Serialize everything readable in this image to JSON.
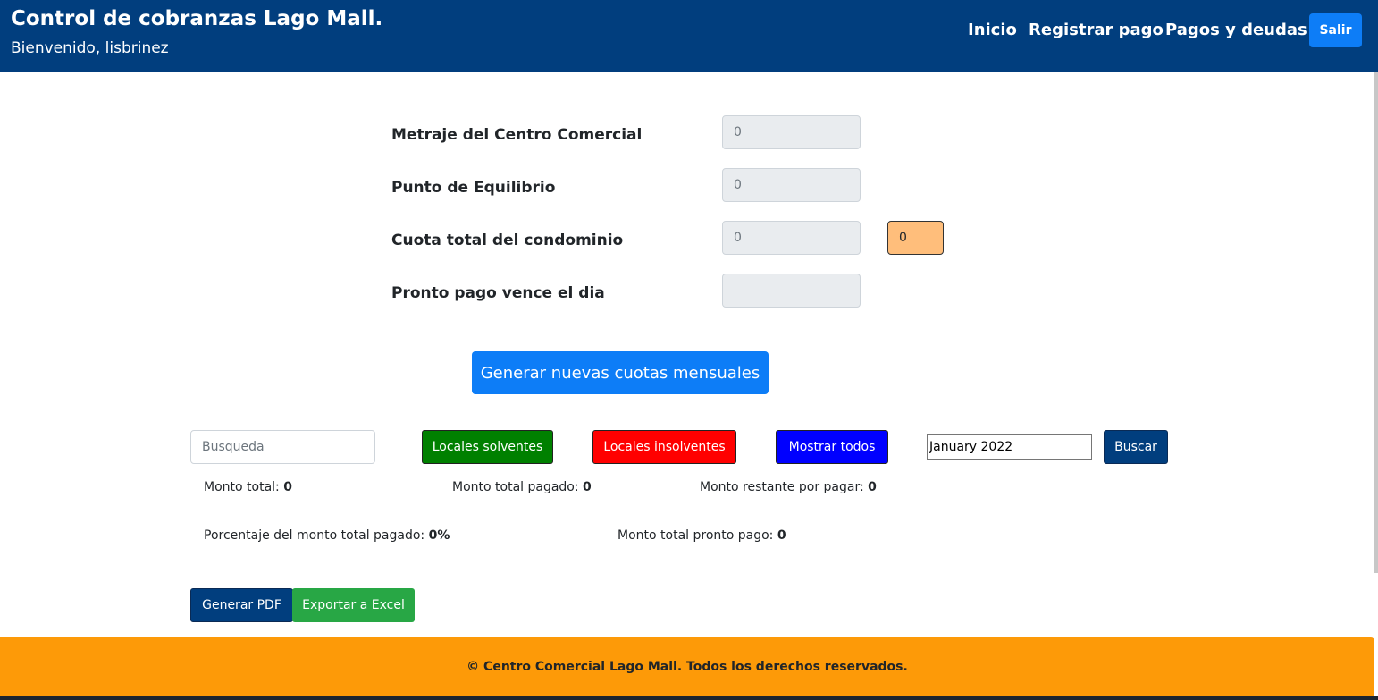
{
  "header": {
    "title": "Control de cobranzas Lago Mall.",
    "welcome": "Bienvenido, lisbrinez",
    "nav": [
      "Inicio",
      "Registrar pago",
      "Pagos y deudas"
    ],
    "logout_label": "Salir",
    "bg_color": "#013e7e"
  },
  "form": {
    "metraje_label": "Metraje del Centro Comercial",
    "metraje_value": "0",
    "equilibrio_label": "Punto de Equilibrio",
    "equilibrio_value": "0",
    "cuota_label": "Cuota total del condominio",
    "cuota_value": "0",
    "cuota_highlight_value": "0",
    "pronto_label": "Pronto pago vence el dia",
    "pronto_value": "",
    "generate_label": "Generar nuevas cuotas mensuales"
  },
  "filters": {
    "search_placeholder": "Busqueda",
    "solventes_label": "Locales solventes",
    "insolventes_label": "Locales insolventes",
    "todos_label": "Mostrar todos",
    "month_value": "January 2022",
    "buscar_label": "Buscar",
    "colors": {
      "solventes": "#008000",
      "insolventes": "#ff0000",
      "todos": "#0000ff"
    }
  },
  "stats": {
    "monto_total_label": "Monto total:",
    "monto_total_value": "0",
    "monto_pagado_label": "Monto total pagado:",
    "monto_pagado_value": "0",
    "monto_restante_label": "Monto restante por pagar:",
    "monto_restante_value": "0",
    "porcentaje_label": "Porcentaje del monto total pagado:",
    "porcentaje_value": "0%",
    "pronto_pago_label": "Monto total pronto pago:",
    "pronto_pago_value": "0"
  },
  "actions": {
    "pdf_label": "Generar PDF",
    "excel_label": "Exportar a Excel"
  },
  "footer": {
    "text": "© Centro Comercial Lago Mall. Todos los derechos reservados.",
    "bg_color": "#fd9a08"
  }
}
